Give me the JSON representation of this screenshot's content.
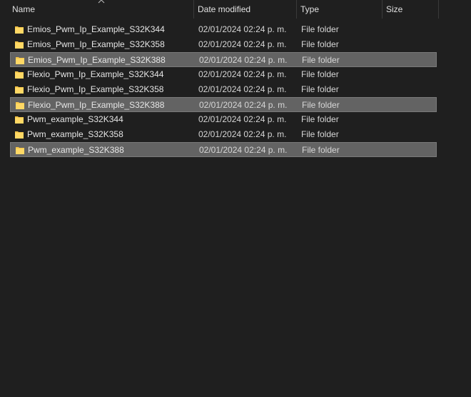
{
  "columns": {
    "name": "Name",
    "date_modified": "Date modified",
    "type": "Type",
    "size": "Size"
  },
  "sort": {
    "column": "name",
    "direction": "ascending",
    "icon": "sort-up-chevron-icon"
  },
  "colors": {
    "background": "#1f1f1f",
    "selected_row": "#636363",
    "folder_icon": "#f4c54a"
  },
  "files": [
    {
      "name": "Emios_Pwm_Ip_Example_S32K344",
      "date": "02/01/2024 02:24 p. m.",
      "type": "File folder",
      "selected": false
    },
    {
      "name": "Emios_Pwm_Ip_Example_S32K358",
      "date": "02/01/2024 02:24 p. m.",
      "type": "File folder",
      "selected": false
    },
    {
      "name": "Emios_Pwm_Ip_Example_S32K388",
      "date": "02/01/2024 02:24 p. m.",
      "type": "File folder",
      "selected": true
    },
    {
      "name": "Flexio_Pwm_Ip_Example_S32K344",
      "date": "02/01/2024 02:24 p. m.",
      "type": "File folder",
      "selected": false
    },
    {
      "name": "Flexio_Pwm_Ip_Example_S32K358",
      "date": "02/01/2024 02:24 p. m.",
      "type": "File folder",
      "selected": false
    },
    {
      "name": "Flexio_Pwm_Ip_Example_S32K388",
      "date": "02/01/2024 02:24 p. m.",
      "type": "File folder",
      "selected": true
    },
    {
      "name": "Pwm_example_S32K344",
      "date": "02/01/2024 02:24 p. m.",
      "type": "File folder",
      "selected": false
    },
    {
      "name": "Pwm_example_S32K358",
      "date": "02/01/2024 02:24 p. m.",
      "type": "File folder",
      "selected": false
    },
    {
      "name": "Pwm_example_S32K388",
      "date": "02/01/2024 02:24 p. m.",
      "type": "File folder",
      "selected": true
    }
  ]
}
